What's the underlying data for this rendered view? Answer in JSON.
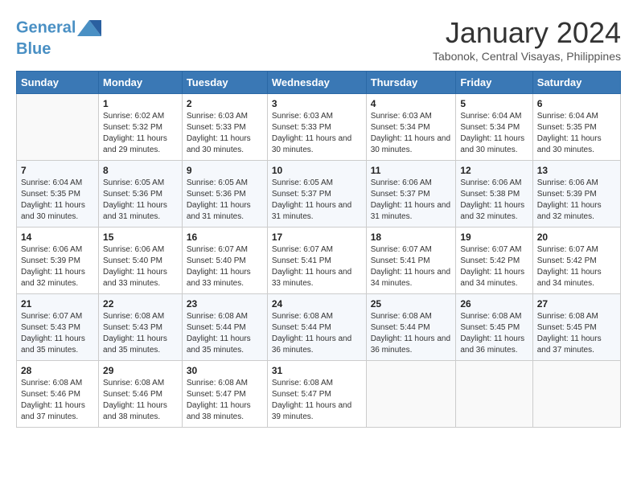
{
  "header": {
    "logo_line1": "General",
    "logo_line2": "Blue",
    "month_title": "January 2024",
    "location": "Tabonok, Central Visayas, Philippines"
  },
  "weekdays": [
    "Sunday",
    "Monday",
    "Tuesday",
    "Wednesday",
    "Thursday",
    "Friday",
    "Saturday"
  ],
  "weeks": [
    [
      {
        "day": "",
        "info": ""
      },
      {
        "day": "1",
        "info": "Sunrise: 6:02 AM\nSunset: 5:32 PM\nDaylight: 11 hours\nand 29 minutes."
      },
      {
        "day": "2",
        "info": "Sunrise: 6:03 AM\nSunset: 5:33 PM\nDaylight: 11 hours\nand 30 minutes."
      },
      {
        "day": "3",
        "info": "Sunrise: 6:03 AM\nSunset: 5:33 PM\nDaylight: 11 hours\nand 30 minutes."
      },
      {
        "day": "4",
        "info": "Sunrise: 6:03 AM\nSunset: 5:34 PM\nDaylight: 11 hours\nand 30 minutes."
      },
      {
        "day": "5",
        "info": "Sunrise: 6:04 AM\nSunset: 5:34 PM\nDaylight: 11 hours\nand 30 minutes."
      },
      {
        "day": "6",
        "info": "Sunrise: 6:04 AM\nSunset: 5:35 PM\nDaylight: 11 hours\nand 30 minutes."
      }
    ],
    [
      {
        "day": "7",
        "info": "Sunrise: 6:04 AM\nSunset: 5:35 PM\nDaylight: 11 hours\nand 30 minutes."
      },
      {
        "day": "8",
        "info": "Sunrise: 6:05 AM\nSunset: 5:36 PM\nDaylight: 11 hours\nand 31 minutes."
      },
      {
        "day": "9",
        "info": "Sunrise: 6:05 AM\nSunset: 5:36 PM\nDaylight: 11 hours\nand 31 minutes."
      },
      {
        "day": "10",
        "info": "Sunrise: 6:05 AM\nSunset: 5:37 PM\nDaylight: 11 hours\nand 31 minutes."
      },
      {
        "day": "11",
        "info": "Sunrise: 6:06 AM\nSunset: 5:37 PM\nDaylight: 11 hours\nand 31 minutes."
      },
      {
        "day": "12",
        "info": "Sunrise: 6:06 AM\nSunset: 5:38 PM\nDaylight: 11 hours\nand 32 minutes."
      },
      {
        "day": "13",
        "info": "Sunrise: 6:06 AM\nSunset: 5:39 PM\nDaylight: 11 hours\nand 32 minutes."
      }
    ],
    [
      {
        "day": "14",
        "info": "Sunrise: 6:06 AM\nSunset: 5:39 PM\nDaylight: 11 hours\nand 32 minutes."
      },
      {
        "day": "15",
        "info": "Sunrise: 6:06 AM\nSunset: 5:40 PM\nDaylight: 11 hours\nand 33 minutes."
      },
      {
        "day": "16",
        "info": "Sunrise: 6:07 AM\nSunset: 5:40 PM\nDaylight: 11 hours\nand 33 minutes."
      },
      {
        "day": "17",
        "info": "Sunrise: 6:07 AM\nSunset: 5:41 PM\nDaylight: 11 hours\nand 33 minutes."
      },
      {
        "day": "18",
        "info": "Sunrise: 6:07 AM\nSunset: 5:41 PM\nDaylight: 11 hours\nand 34 minutes."
      },
      {
        "day": "19",
        "info": "Sunrise: 6:07 AM\nSunset: 5:42 PM\nDaylight: 11 hours\nand 34 minutes."
      },
      {
        "day": "20",
        "info": "Sunrise: 6:07 AM\nSunset: 5:42 PM\nDaylight: 11 hours\nand 34 minutes."
      }
    ],
    [
      {
        "day": "21",
        "info": "Sunrise: 6:07 AM\nSunset: 5:43 PM\nDaylight: 11 hours\nand 35 minutes."
      },
      {
        "day": "22",
        "info": "Sunrise: 6:08 AM\nSunset: 5:43 PM\nDaylight: 11 hours\nand 35 minutes."
      },
      {
        "day": "23",
        "info": "Sunrise: 6:08 AM\nSunset: 5:44 PM\nDaylight: 11 hours\nand 35 minutes."
      },
      {
        "day": "24",
        "info": "Sunrise: 6:08 AM\nSunset: 5:44 PM\nDaylight: 11 hours\nand 36 minutes."
      },
      {
        "day": "25",
        "info": "Sunrise: 6:08 AM\nSunset: 5:44 PM\nDaylight: 11 hours\nand 36 minutes."
      },
      {
        "day": "26",
        "info": "Sunrise: 6:08 AM\nSunset: 5:45 PM\nDaylight: 11 hours\nand 36 minutes."
      },
      {
        "day": "27",
        "info": "Sunrise: 6:08 AM\nSunset: 5:45 PM\nDaylight: 11 hours\nand 37 minutes."
      }
    ],
    [
      {
        "day": "28",
        "info": "Sunrise: 6:08 AM\nSunset: 5:46 PM\nDaylight: 11 hours\nand 37 minutes."
      },
      {
        "day": "29",
        "info": "Sunrise: 6:08 AM\nSunset: 5:46 PM\nDaylight: 11 hours\nand 38 minutes."
      },
      {
        "day": "30",
        "info": "Sunrise: 6:08 AM\nSunset: 5:47 PM\nDaylight: 11 hours\nand 38 minutes."
      },
      {
        "day": "31",
        "info": "Sunrise: 6:08 AM\nSunset: 5:47 PM\nDaylight: 11 hours\nand 39 minutes."
      },
      {
        "day": "",
        "info": ""
      },
      {
        "day": "",
        "info": ""
      },
      {
        "day": "",
        "info": ""
      }
    ]
  ]
}
